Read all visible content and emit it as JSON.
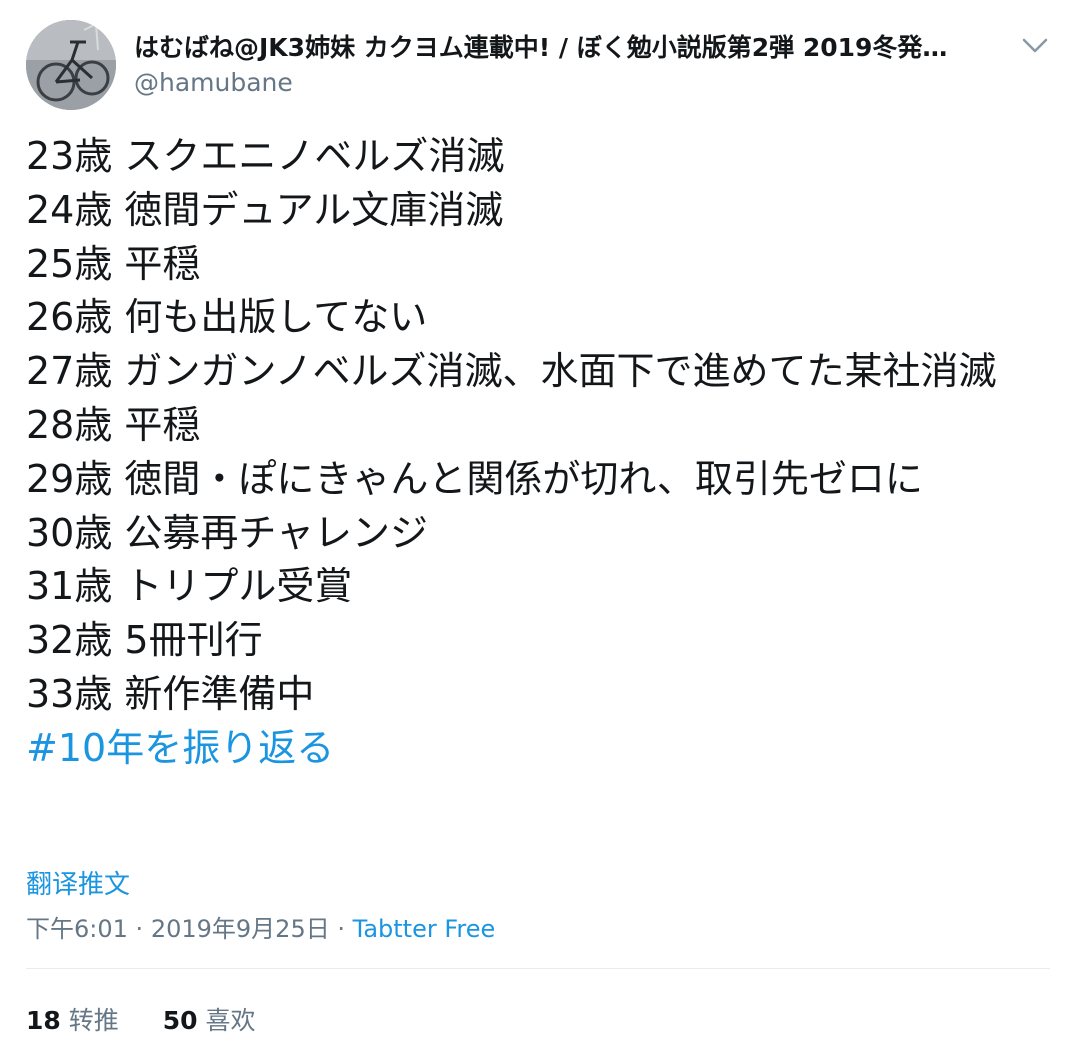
{
  "user": {
    "display_name": "はむばね@JK3姉妹 カクヨム連載中! / ぼく勉小説版第2弾 2019冬発…",
    "handle": "@hamubane"
  },
  "tweet": {
    "lines": [
      "23歳 スクエニノベルズ消滅",
      "24歳 徳間デュアル文庫消滅",
      "25歳 平穏",
      "26歳 何も出版してない",
      "27歳 ガンガンノベルズ消滅、水面下で進めてた某社消滅",
      "28歳 平穏",
      "29歳 徳間・ぽにきゃんと関係が切れ、取引先ゼロに",
      "30歳 公募再チャレンジ",
      "31歳 トリプル受賞",
      "32歳 5冊刊行",
      "33歳 新作準備中"
    ],
    "hashtag": "#10年を振り返る",
    "translate_label": "翻译推文",
    "time": "下午6:01",
    "date": "2019年9月25日",
    "separator": "·",
    "source": "Tabtter Free"
  },
  "stats": {
    "retweets_count": "18",
    "retweets_label": "转推",
    "likes_count": "50",
    "likes_label": "喜欢"
  },
  "colors": {
    "link": "#1b95e0",
    "secondary": "#657786",
    "text": "#14171a",
    "divider": "#e6ecf0"
  },
  "icons": {
    "avatar": "bicycle-photo-avatar",
    "menu": "chevron-down-icon"
  }
}
